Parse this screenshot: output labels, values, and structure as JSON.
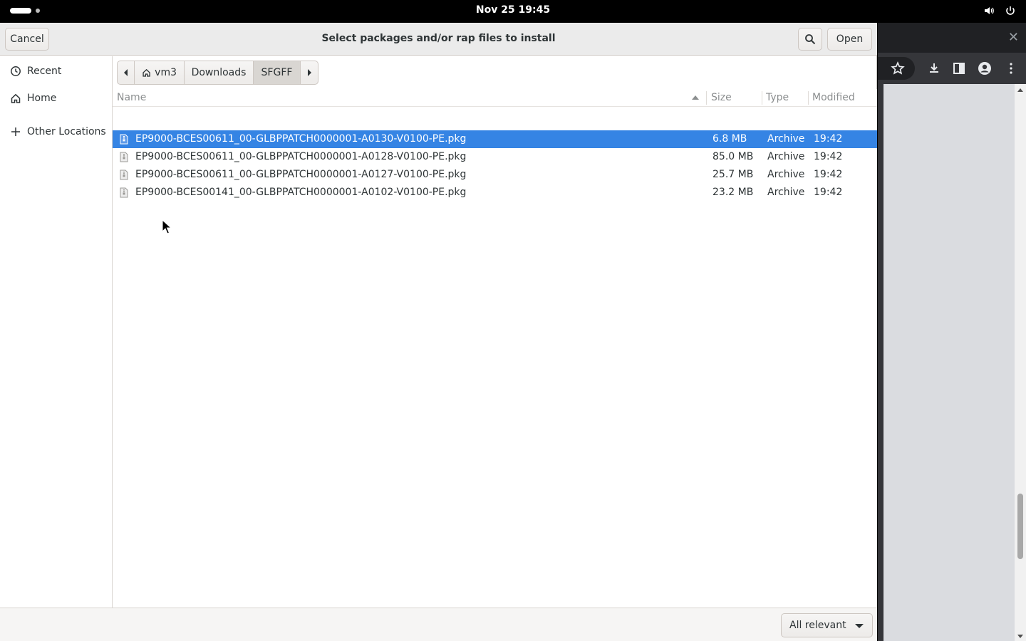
{
  "topbar": {
    "clock": "Nov 25  19:45",
    "icons": [
      "volume-icon",
      "power-icon"
    ]
  },
  "dialog": {
    "title": "Select packages and/or rap files to install",
    "cancel_label": "Cancel",
    "open_label": "Open",
    "search_icon": "search-icon"
  },
  "sidebar": {
    "items": [
      {
        "label": "Recent",
        "icon": "clock-icon"
      },
      {
        "label": "Home",
        "icon": "home-icon"
      },
      {
        "label": "Other Locations",
        "icon": "plus-icon"
      }
    ]
  },
  "pathbar": {
    "segments": [
      "vm3",
      "Downloads",
      "SFGFF"
    ],
    "active": "SFGFF"
  },
  "columns": {
    "name": "Name",
    "size": "Size",
    "type": "Type",
    "modified": "Modified"
  },
  "files": [
    {
      "name": "EP9000-BCES00611_00-GLBPPATCH0000001-A0130-V0100-PE.pkg",
      "size": "6.8 MB",
      "type": "Archive",
      "modified": "19:42",
      "selected": true
    },
    {
      "name": "EP9000-BCES00611_00-GLBPPATCH0000001-A0128-V0100-PE.pkg",
      "size": "85.0 MB",
      "type": "Archive",
      "modified": "19:42",
      "selected": false
    },
    {
      "name": "EP9000-BCES00611_00-GLBPPATCH0000001-A0127-V0100-PE.pkg",
      "size": "25.7 MB",
      "type": "Archive",
      "modified": "19:42",
      "selected": false
    },
    {
      "name": "EP9000-BCES00141_00-GLBPPATCH0000001-A0102-V0100-PE.pkg",
      "size": "23.2 MB",
      "type": "Archive",
      "modified": "19:42",
      "selected": false
    }
  ],
  "footer": {
    "filter_value": "All relevant"
  },
  "colors": {
    "selection": "#3584e4",
    "topbar": "#000000"
  }
}
